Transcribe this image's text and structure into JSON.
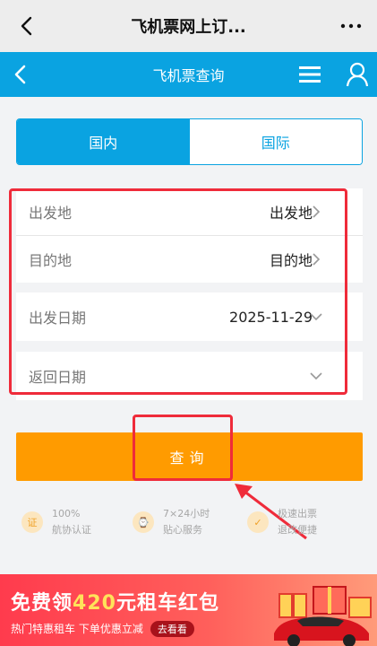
{
  "topbar": {
    "title": "飞机票网上订..."
  },
  "header": {
    "title": "飞机票查询"
  },
  "tabs": {
    "domestic": "国内",
    "international": "国际"
  },
  "form": {
    "departure": {
      "label": "出发地",
      "value": "出发地"
    },
    "destination": {
      "label": "目的地",
      "value": "目的地"
    },
    "depart_date": {
      "label": "出发日期",
      "value": "2025-11-29"
    },
    "return_date": {
      "label": "返回日期",
      "value": ""
    }
  },
  "query_button": "查询",
  "guarantees": [
    {
      "line1": "100%",
      "line2": "航协认证",
      "icon": "certificate-icon",
      "glyph": "证"
    },
    {
      "line1": "7×24小时",
      "line2": "贴心服务",
      "icon": "clock-icon",
      "glyph": "⌚"
    },
    {
      "line1": "极速出票",
      "line2": "退改便捷",
      "icon": "check-icon",
      "glyph": "✓"
    }
  ],
  "banner": {
    "headline_pre": "免费领",
    "headline_num": "420",
    "headline_post": "元租车红包",
    "subline": "热门特惠租车 下单优惠立减",
    "cta": "去看看"
  },
  "colors": {
    "brand_blue": "#0aa3e1",
    "orange": "#ff9b00",
    "annotation_red": "#ef2b3a"
  }
}
